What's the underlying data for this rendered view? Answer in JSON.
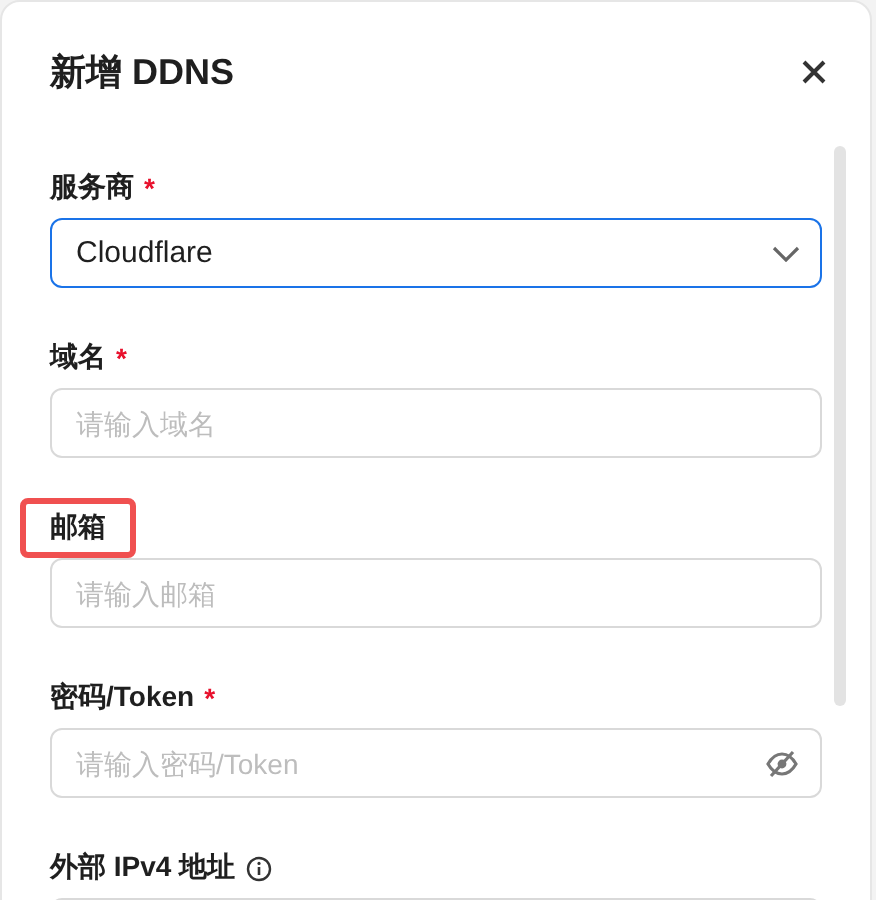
{
  "dialog": {
    "title": "新增 DDNS"
  },
  "fields": [
    {
      "kind": "select",
      "label": "服务商",
      "required_mark": "*",
      "highlighted": false,
      "info": false,
      "value": "Cloudflare",
      "focused": true
    },
    {
      "kind": "text",
      "label": "域名",
      "required_mark": "*",
      "highlighted": false,
      "info": false,
      "placeholder": "请输入域名",
      "focused": false
    },
    {
      "kind": "text",
      "label": "邮箱",
      "highlighted": true,
      "info": false,
      "placeholder": "请输入邮箱",
      "focused": false
    },
    {
      "kind": "password",
      "label": "密码/Token",
      "required_mark": "*",
      "highlighted": false,
      "info": false,
      "placeholder": "请输入密码/Token",
      "focused": false
    },
    {
      "kind": "text",
      "label": "外部 IPv4 地址",
      "highlighted": false,
      "info": true
    }
  ]
}
